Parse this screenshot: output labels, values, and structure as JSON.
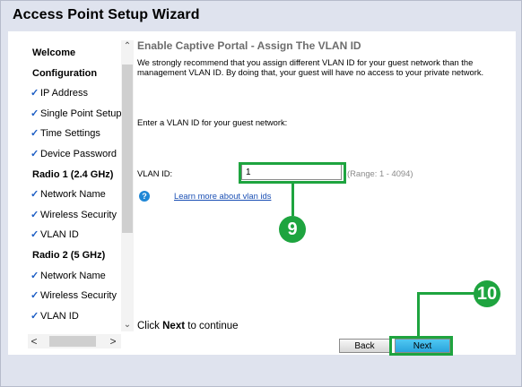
{
  "window": {
    "title": "Access Point Setup Wizard"
  },
  "sidebar": {
    "items": [
      {
        "label": "Welcome",
        "type": "section",
        "check": ""
      },
      {
        "label": "Configuration",
        "type": "section",
        "check": ""
      },
      {
        "label": "IP Address",
        "type": "step",
        "check": "✓"
      },
      {
        "label": "Single Point Setup",
        "type": "step",
        "check": "✓"
      },
      {
        "label": "Time Settings",
        "type": "step",
        "check": "✓"
      },
      {
        "label": "Device Password",
        "type": "step",
        "check": "✓"
      },
      {
        "label": "Radio 1 (2.4 GHz)",
        "type": "section",
        "check": ""
      },
      {
        "label": "Network Name",
        "type": "step",
        "check": "✓"
      },
      {
        "label": "Wireless Security",
        "type": "step",
        "check": "✓"
      },
      {
        "label": "VLAN ID",
        "type": "step",
        "check": "✓"
      },
      {
        "label": "Radio 2 (5 GHz)",
        "type": "section",
        "check": ""
      },
      {
        "label": "Network Name",
        "type": "step",
        "check": "✓"
      },
      {
        "label": "Wireless Security",
        "type": "step",
        "check": "✓"
      },
      {
        "label": "VLAN ID",
        "type": "step",
        "check": "✓"
      }
    ],
    "scroll_up_icon": "chevron-up",
    "scroll_down_icon": "chevron-down",
    "scroll_left": "<",
    "scroll_right": ">"
  },
  "main": {
    "heading": "Enable Captive Portal - Assign The VLAN ID",
    "description": "We strongly recommend that you assign different VLAN ID for your guest network than the management VLAN ID. By doing that, your guest will have no access to your private network.",
    "prompt": "Enter a VLAN ID for your guest network:",
    "vlan_label": "VLAN ID:",
    "vlan_value": "1",
    "range": "(Range: 1 - 4094)",
    "help_icon": "?",
    "learn_link": "Learn more about vlan ids",
    "continue_prefix": "Click ",
    "continue_bold": "Next",
    "continue_suffix": " to continue"
  },
  "buttons": {
    "back": "Back",
    "next": "Next"
  },
  "annotations": {
    "marker_input": "9",
    "marker_next": "10"
  },
  "colors": {
    "highlight": "#1ea43f",
    "check": "#1a5cc4",
    "link": "#1a4fb4",
    "next_button": "#2aa4dc"
  }
}
